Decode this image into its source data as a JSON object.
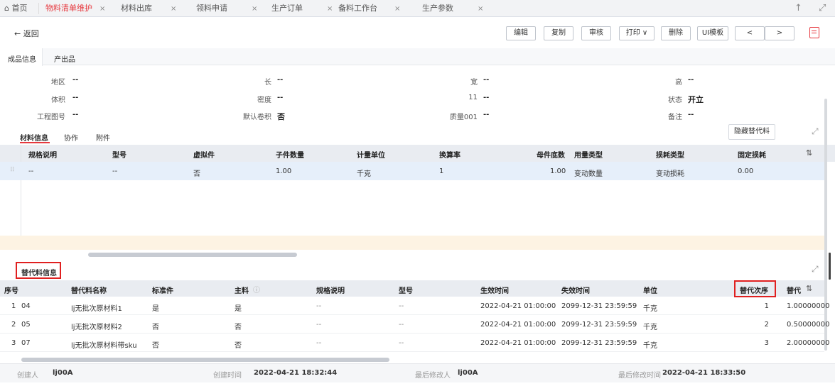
{
  "tabs": [
    {
      "label": "首页",
      "closable": false
    },
    {
      "label": "物料清单维护",
      "closable": true,
      "active": true
    },
    {
      "label": "材料出库",
      "closable": true
    },
    {
      "label": "领料申请",
      "closable": true
    },
    {
      "label": "生产订单",
      "closable": true
    },
    {
      "label": "备料工作台",
      "closable": true
    },
    {
      "label": "生产参数",
      "closable": true
    }
  ],
  "close_glyph": "×",
  "home_icon": "⌂",
  "toolbar": {
    "back": "← 返回",
    "edit": "编辑",
    "copy": "复制",
    "audit": "审核",
    "print": "打印 ∨",
    "delete": "删除",
    "ui_template": "UI模板",
    "prev": "<",
    "next": ">"
  },
  "section_tabs": [
    "成品信息",
    "产出品"
  ],
  "info_fields": [
    {
      "label": "地区",
      "value": "--"
    },
    {
      "label": "长",
      "value": "--"
    },
    {
      "label": "宽",
      "value": "--"
    },
    {
      "label": "高",
      "value": "--"
    },
    {
      "label": "体积",
      "value": "--"
    },
    {
      "label": "密度",
      "value": "--"
    },
    {
      "label": "11",
      "value": "--"
    },
    {
      "label": "状态",
      "value": "开立"
    },
    {
      "label": "工程图号",
      "value": "--"
    },
    {
      "label": "默认卷积",
      "value": "否"
    },
    {
      "label": "质量001",
      "value": "--"
    },
    {
      "label": "备注",
      "value": "--"
    }
  ],
  "material_tabs": [
    "材料信息",
    "协作",
    "附件"
  ],
  "hide_sub_button": "隐藏替代料",
  "material_table": {
    "headers": [
      "规格说明",
      "型号",
      "虚拟件",
      "子件数量",
      "计量单位",
      "换算率",
      "母件底数",
      "用量类型",
      "损耗类型",
      "固定损耗"
    ],
    "rows": [
      [
        "--",
        "--",
        "否",
        "1.00",
        "千克",
        "1",
        "1.00",
        "变动数量",
        "变动损耗",
        "0.00"
      ]
    ]
  },
  "sub_section_title": "替代料信息",
  "sub_table": {
    "headers": [
      "序号",
      "替代料名称",
      "标准件",
      "主料",
      "规格说明",
      "型号",
      "生效时间",
      "失效时间",
      "单位",
      "替代次序",
      "替代"
    ],
    "rows": [
      {
        "no": "1",
        "code": "04",
        "name": "lj无批次原材料1",
        "std": "是",
        "main": "是",
        "spec": "--",
        "model": "--",
        "start": "2022-04-21 01:00:00",
        "end": "2099-12-31 23:59:59",
        "unit": "千克",
        "order": "1",
        "ratio": "1.00000000"
      },
      {
        "no": "2",
        "code": "05",
        "name": "lj无批次原材料2",
        "std": "否",
        "main": "否",
        "spec": "--",
        "model": "--",
        "start": "2022-04-21 01:00:00",
        "end": "2099-12-31 23:59:59",
        "unit": "千克",
        "order": "2",
        "ratio": "0.50000000"
      },
      {
        "no": "3",
        "code": "07",
        "name": "lj无批次原材料带sku",
        "std": "否",
        "main": "否",
        "spec": "--",
        "model": "--",
        "start": "2022-04-21 01:00:00",
        "end": "2099-12-31 23:59:59",
        "unit": "千克",
        "order": "3",
        "ratio": "2.00000000"
      }
    ]
  },
  "footer": {
    "creator_label": "创建人",
    "creator": "lj00A",
    "created_label": "创建时间",
    "created": "2022-04-21 18:32:44",
    "modifier_label": "最后修改人",
    "modifier": "lj00A",
    "modified_label": "最后修改时间",
    "modified": "2022-04-21 18:33:50"
  },
  "colors": {
    "accent": "#e6393f",
    "highlight_box": "#e02020",
    "header_bg": "#e9ecf1",
    "selected_row": "#e6effa",
    "empty_row": "#fdf3e3"
  }
}
